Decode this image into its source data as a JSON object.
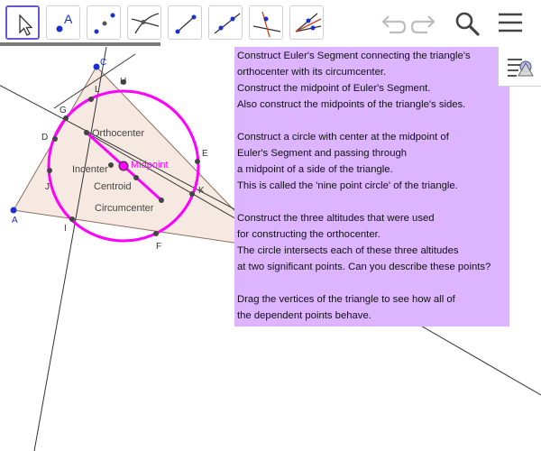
{
  "toolbar": {
    "tools": [
      {
        "name": "move-tool",
        "active": true
      },
      {
        "name": "point-tool",
        "label": "A"
      },
      {
        "name": "midpoint-tool"
      },
      {
        "name": "intersect-tool"
      },
      {
        "name": "segment-tool"
      },
      {
        "name": "ray-tool"
      },
      {
        "name": "perpendicular-line-tool"
      },
      {
        "name": "angle-bisector-tool"
      }
    ],
    "right_icons": [
      "undo-icon",
      "redo-icon",
      "search-icon",
      "menu-icon"
    ]
  },
  "construction": {
    "points": {
      "A": "A",
      "C": "C",
      "H": "H",
      "L": "L",
      "G": "G",
      "D": "D",
      "J": "J",
      "I": "I",
      "E": "E",
      "K": "K",
      "F": "F"
    },
    "centers": {
      "orthocenter": "Orthocenter",
      "incenter": "Incenter",
      "midpoint": "Midpoint",
      "centroid": "Centroid",
      "circumcenter": "Circumcenter"
    },
    "colors": {
      "triangle_fill": "#f5e9e1",
      "circle": "#ff00ff",
      "vertex": "#1a2fcf",
      "notes_bg": "#dcb4ff"
    }
  },
  "notes": {
    "lines": [
      "Construct Euler's Segment connecting the triangle's",
      "orthocenter with its circumcenter.",
      "Construct the midpoint of Euler's Segment.",
      "Also construct the midpoints of the triangle's sides.",
      "",
      "Construct a circle with center at the midpoint of",
      "Euler's Segment and passing through",
      "a midpoint of a side of the triangle.",
      "This is called the 'nine point circle' of the triangle.",
      "",
      "Construct the three altitudes that were used",
      "for constructing the orthocenter.",
      "The circle intersects each of these three altitudes",
      "at two significant points. Can you describe these points?",
      "",
      "Drag the vertices of the triangle to see how all of",
      "the dependent points behave."
    ]
  }
}
